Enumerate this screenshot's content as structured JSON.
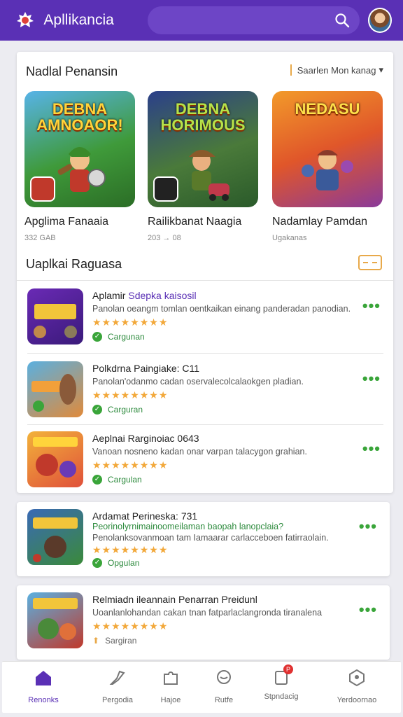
{
  "header": {
    "app_title": "Apllikancia",
    "search_placeholder": "",
    "accent_color": "#5a30b5"
  },
  "featured": {
    "section_title": "Nadlal Penansin",
    "sort_label": "Saarlen Mon kanag",
    "games": [
      {
        "banner": "DEBNA AMNOAOR!",
        "name": "Apglima Fanaaia",
        "sub": "332 GAB"
      },
      {
        "banner": "DEBNA HORIMOUS",
        "name": "Railikbanat Naagia",
        "sub": "203 → 08"
      },
      {
        "banner": "NEDASU",
        "name": "Nadamlay Pamdan",
        "sub": "Ugakanas"
      }
    ]
  },
  "list": {
    "section_title": "Uaplkai Raguasa",
    "items": [
      {
        "title": "Aplamir",
        "title_highlight": "Sdepka kaisosil",
        "desc": "Panolan oeangm tomlan oentkaikan einang panderadan panodian.",
        "stars": "★★★★★★★★",
        "status": "Cargunan"
      },
      {
        "title": "Polkdrna Paingiake: C11",
        "title_highlight": "",
        "desc": "Panolan'odanmo cadan oservalecolcalaokgen pladian.",
        "stars": "★★★★★★★★",
        "status": "Carguran"
      },
      {
        "title": "Aeplnai Rarginoiac 0643",
        "title_highlight": "",
        "desc": "Vanoan nosneno kadan onar varpan talacygon grahian.",
        "stars": "★★★★★★★★",
        "status": "Cargulan"
      }
    ]
  },
  "standalone": [
    {
      "title": "Ardamat Perineska: 731",
      "subtitle": "Peorinolyrnimainoomeilaman baopah lanopclaia?",
      "desc": "Penolanksovanmoan tam  Iamaarar carlacceboen fatirraolain.",
      "stars": "★★★★★★★★",
      "status": "Opgulan"
    },
    {
      "title": "Relmiadn ileannain Penarran Preidunl",
      "subtitle": "",
      "desc": "Uoanlanlohandan cakan  tnan fatparlaclangronda tiranalena",
      "stars": "★★★★★★★★",
      "status": "Sargiran"
    }
  ],
  "nav": {
    "items": [
      {
        "label": "Renonks"
      },
      {
        "label": "Pergodia"
      },
      {
        "label": "Hajoe"
      },
      {
        "label": "Rutfe"
      },
      {
        "label": "Stpndacig"
      },
      {
        "label": "Yerdoornao"
      }
    ],
    "badge": "P"
  }
}
